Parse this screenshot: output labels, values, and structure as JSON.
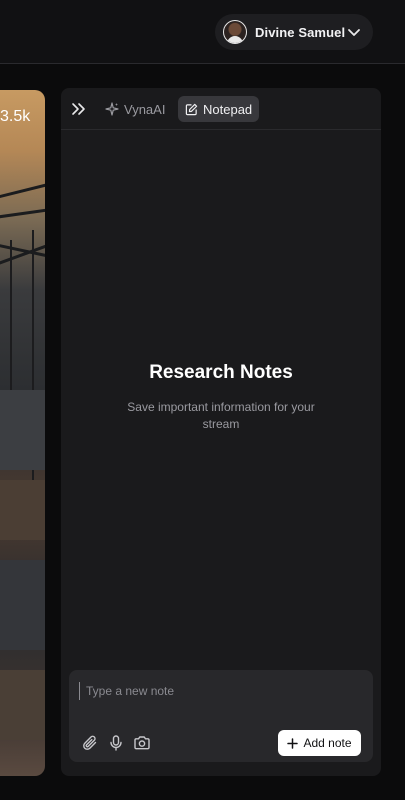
{
  "header": {
    "user": {
      "name": "Divine Samuel",
      "avatar_icon": "avatar-photo",
      "menu_icon": "chevron-down-icon"
    }
  },
  "stream": {
    "viewer_count": "3.5k"
  },
  "panel": {
    "collapse_icon": "double-chevron-right-icon",
    "tabs": [
      {
        "label": "VynaAI",
        "icon": "sparkle-icon",
        "active": false
      },
      {
        "label": "Notepad",
        "icon": "note-edit-icon",
        "active": true
      }
    ],
    "empty_state": {
      "title": "Research Notes",
      "subtitle": "Save important information for your stream"
    },
    "composer": {
      "placeholder": "Type a new note",
      "value": "",
      "tools": [
        "paperclip-icon",
        "microphone-icon",
        "camera-icon"
      ],
      "submit_label": "Add note"
    }
  },
  "colors": {
    "background": "#0b0b0c",
    "panel": "#1a1a1c",
    "active_tab": "#38383c",
    "button": "#ffffff"
  }
}
